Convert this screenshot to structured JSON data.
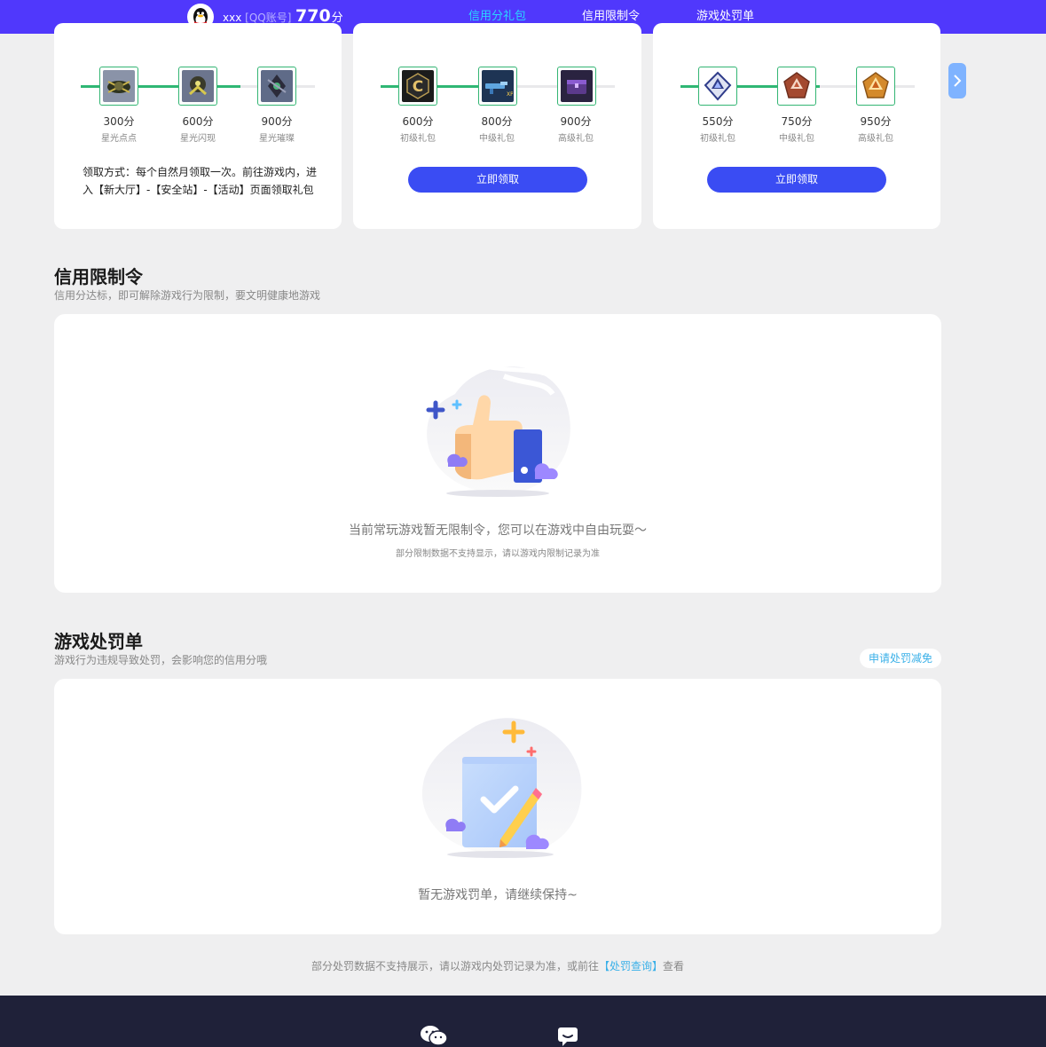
{
  "header": {
    "username": "xxx",
    "account_type": "[QQ账号]",
    "score": "770",
    "score_unit": "分",
    "nav": [
      {
        "label": "信用分礼包"
      },
      {
        "label": "信用限制令"
      },
      {
        "label": "游戏处罚单"
      }
    ]
  },
  "gift_cards": [
    {
      "items": [
        {
          "points": "300分",
          "name": "星光点点"
        },
        {
          "points": "600分",
          "name": "星光闪现"
        },
        {
          "points": "900分",
          "name": "星光璀璨"
        }
      ],
      "note": "领取方式：每个自然月领取一次。前往游戏内，进入【新大厅】-【安全站】-【活动】页面领取礼包"
    },
    {
      "items": [
        {
          "points": "600分",
          "name": "初级礼包"
        },
        {
          "points": "800分",
          "name": "中级礼包"
        },
        {
          "points": "900分",
          "name": "高级礼包"
        }
      ],
      "button": "立即领取"
    },
    {
      "items": [
        {
          "points": "550分",
          "name": "初级礼包"
        },
        {
          "points": "750分",
          "name": "中级礼包"
        },
        {
          "points": "950分",
          "name": "高级礼包"
        }
      ],
      "button": "立即领取"
    }
  ],
  "restriction": {
    "title": "信用限制令",
    "subtitle": "信用分达标，即可解除游戏行为限制，要文明健康地游戏",
    "empty_message": "当前常玩游戏暂无限制令，您可以在游戏中自由玩耍～",
    "empty_note": "部分限制数据不支持显示，请以游戏内限制记录为准"
  },
  "penalty": {
    "title": "游戏处罚单",
    "subtitle": "游戏行为违规导致处罚，会影响您的信用分哦",
    "appeal_button": "申请处罚减免",
    "empty_message": "暂无游戏罚单，请继续保持~",
    "bottom_note_prefix": "部分处罚数据不支持展示，请以游戏内处罚记录为准，或前往",
    "bottom_note_link": "【处罚查询】",
    "bottom_note_suffix": "查看"
  },
  "colors": {
    "topbar": "#5038fc",
    "active_tab": "#29d6ff",
    "progress": "#2fb774",
    "claim_button": "#3a4cf3",
    "footer": "#1f2139"
  }
}
